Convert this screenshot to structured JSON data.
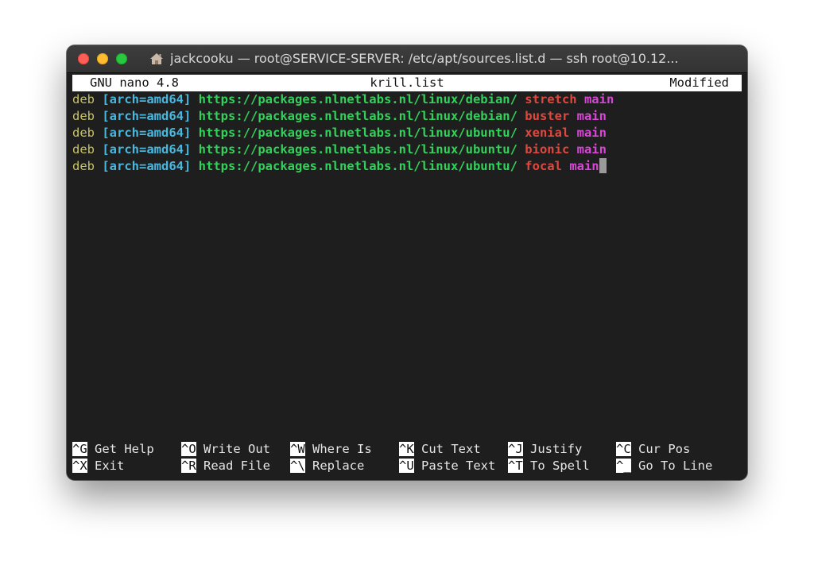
{
  "window": {
    "title": "jackcooku — root@SERVICE-SERVER: /etc/apt/sources.list.d — ssh root@10.12..."
  },
  "nano": {
    "version": "GNU nano 4.8",
    "filename": "krill.list",
    "status": "Modified"
  },
  "lines": [
    {
      "type": "deb",
      "options": "[arch=amd64]",
      "uri": "https://packages.nlnetlabs.nl/linux/debian/",
      "suite": "stretch",
      "component": "main"
    },
    {
      "type": "deb",
      "options": "[arch=amd64]",
      "uri": "https://packages.nlnetlabs.nl/linux/debian/",
      "suite": "buster",
      "component": "main"
    },
    {
      "type": "deb",
      "options": "[arch=amd64]",
      "uri": "https://packages.nlnetlabs.nl/linux/ubuntu/",
      "suite": "xenial",
      "component": "main"
    },
    {
      "type": "deb",
      "options": "[arch=amd64]",
      "uri": "https://packages.nlnetlabs.nl/linux/ubuntu/",
      "suite": "bionic",
      "component": "main"
    },
    {
      "type": "deb",
      "options": "[arch=amd64]",
      "uri": "https://packages.nlnetlabs.nl/linux/ubuntu/",
      "suite": "focal",
      "component": "main"
    }
  ],
  "shortcuts": [
    [
      {
        "key": "^G",
        "label": "Get Help"
      },
      {
        "key": "^O",
        "label": "Write Out"
      },
      {
        "key": "^W",
        "label": "Where Is"
      },
      {
        "key": "^K",
        "label": "Cut Text"
      },
      {
        "key": "^J",
        "label": "Justify"
      },
      {
        "key": "^C",
        "label": "Cur Pos"
      }
    ],
    [
      {
        "key": "^X",
        "label": "Exit"
      },
      {
        "key": "^R",
        "label": "Read File"
      },
      {
        "key": "^\\",
        "label": "Replace"
      },
      {
        "key": "^U",
        "label": "Paste Text"
      },
      {
        "key": "^T",
        "label": "To Spell"
      },
      {
        "key": "^_",
        "label": "Go To Line"
      }
    ]
  ],
  "colors": {
    "traffic_close": "#fd5f57",
    "traffic_minimize": "#febc2e",
    "traffic_zoom": "#28c840",
    "terminal_bg": "#1e1e1e",
    "syntax_type": "#c6c268",
    "syntax_options": "#47b8e0",
    "syntax_uri": "#33d15b",
    "syntax_suite": "#e0483f",
    "syntax_component": "#d946d8"
  },
  "icons": {
    "window_proxy": "home-icon"
  }
}
